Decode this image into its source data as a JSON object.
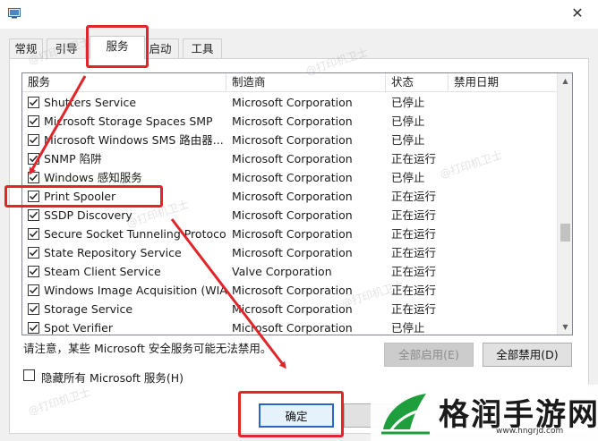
{
  "tabs": [
    {
      "label": "常规"
    },
    {
      "label": "引导"
    },
    {
      "label": "服务"
    },
    {
      "label": "启动"
    },
    {
      "label": "工具"
    }
  ],
  "active_tab": "服务",
  "columns": {
    "service": "服务",
    "manufacturer": "制造商",
    "status": "状态",
    "disabled_date": "禁用日期"
  },
  "rows": [
    {
      "checked": true,
      "service": "Shutters Service",
      "manufacturer": "Microsoft Corporation",
      "status": "已停止"
    },
    {
      "checked": true,
      "service": "Microsoft Storage Spaces SMP",
      "manufacturer": "Microsoft Corporation",
      "status": "已停止"
    },
    {
      "checked": true,
      "service": "Microsoft Windows SMS 路由器...",
      "manufacturer": "Microsoft Corporation",
      "status": "已停止"
    },
    {
      "checked": true,
      "service": "SNMP 陷阱",
      "manufacturer": "Microsoft Corporation",
      "status": "正在运行"
    },
    {
      "checked": true,
      "service": "Windows 感知服务",
      "manufacturer": "Microsoft Corporation",
      "status": "已停止"
    },
    {
      "checked": true,
      "service": "Print Spooler",
      "manufacturer": "Microsoft Corporation",
      "status": "正在运行"
    },
    {
      "checked": true,
      "service": "SSDP Discovery",
      "manufacturer": "Microsoft Corporation",
      "status": "正在运行"
    },
    {
      "checked": true,
      "service": "Secure Socket Tunneling Protoco...",
      "manufacturer": "Microsoft Corporation",
      "status": "正在运行"
    },
    {
      "checked": true,
      "service": "State Repository Service",
      "manufacturer": "Microsoft Corporation",
      "status": "正在运行"
    },
    {
      "checked": true,
      "service": "Steam Client Service",
      "manufacturer": "Valve Corporation",
      "status": "正在运行"
    },
    {
      "checked": true,
      "service": "Windows Image Acquisition (WIA)",
      "manufacturer": "Microsoft Corporation",
      "status": "正在运行"
    },
    {
      "checked": true,
      "service": "Storage Service",
      "manufacturer": "Microsoft Corporation",
      "status": "正在运行"
    },
    {
      "checked": true,
      "service": "Spot Verifier",
      "manufacturer": "Microsoft Corporation",
      "status": "已停止"
    }
  ],
  "notice": "请注意，某些 Microsoft 安全服务可能无法禁用。",
  "enable_all_label": "全部启用(E)",
  "disable_all_label": "全部禁用(D)",
  "hide_ms_label": "隐藏所有 Microsoft 服务(H)",
  "hide_ms_checked": false,
  "ok_label": "确定",
  "watermark_text": "@打印机卫士",
  "brand_logo": {
    "name": "格润手游网",
    "url": "www.hngrjd.com"
  },
  "colors": {
    "highlight_red": "#e0262b",
    "ok_border": "#2a64c5",
    "brand_green": "#1f9e3d"
  }
}
